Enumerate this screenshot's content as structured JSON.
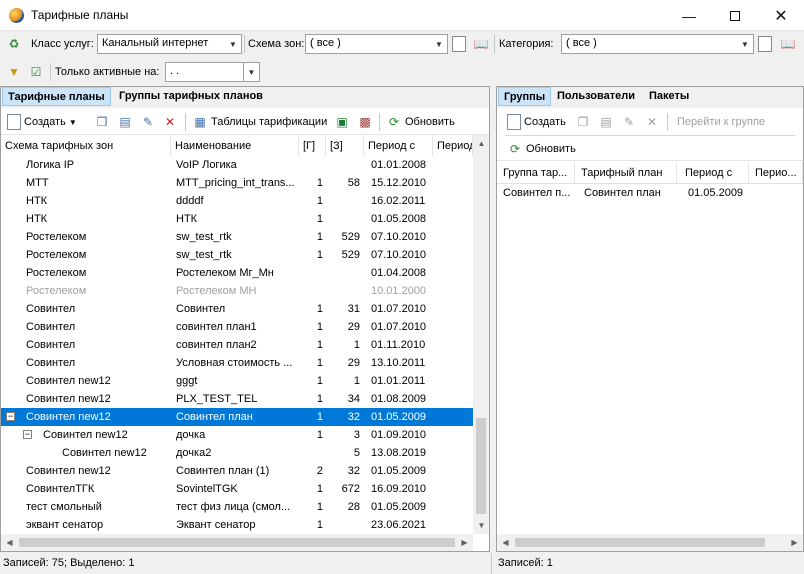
{
  "window": {
    "title": "Тарифные планы"
  },
  "filters": {
    "service_class_label": "Класс услуг:",
    "service_class_value": "Канальный интернет",
    "zone_scheme_label": "Схема зон:",
    "zone_scheme_value": "( все )",
    "category_label": "Категория:",
    "category_value": "( все )",
    "active_only_label": "Только активные на:",
    "active_only_value": " .  ."
  },
  "left": {
    "tabs": [
      "Тарифные планы",
      "Группы тарифных планов"
    ],
    "toolbar": {
      "create": "Создать",
      "tariff_tables": "Таблицы тарификации",
      "refresh": "Обновить"
    },
    "columns": [
      "Схема тарифных зон",
      "Наименование",
      "[Г]",
      "[З]",
      "Период с",
      "Период по"
    ],
    "rows": [
      {
        "scheme": "Логика IP",
        "name": "VoIP Логика",
        "g": "",
        "z": "",
        "from": "01.01.2008"
      },
      {
        "scheme": "МТТ",
        "name": "MTT_pricing_int_trans...",
        "g": "1",
        "z": "58",
        "from": "15.12.2010"
      },
      {
        "scheme": "НТК",
        "name": "ddddf",
        "g": "1",
        "z": "",
        "from": "16.02.2011"
      },
      {
        "scheme": "НТК",
        "name": "НТК",
        "g": "1",
        "z": "",
        "from": "01.05.2008"
      },
      {
        "scheme": "Ростелеком",
        "name": "sw_test_rtk",
        "g": "1",
        "z": "529",
        "from": "07.10.2010"
      },
      {
        "scheme": "Ростелеком",
        "name": "sw_test_rtk",
        "g": "1",
        "z": "529",
        "from": "07.10.2010"
      },
      {
        "scheme": "Ростелеком",
        "name": "Ростелеком Мг_Мн",
        "g": "",
        "z": "",
        "from": "01.04.2008"
      },
      {
        "scheme": "Ростелеком",
        "name": "Ростелеком МН",
        "g": "",
        "z": "",
        "from": "10.01.2000"
      },
      {
        "scheme": "Совинтел",
        "name": "Совинтел",
        "g": "1",
        "z": "31",
        "from": "01.07.2010"
      },
      {
        "scheme": "Совинтел",
        "name": "совинтел план1",
        "g": "1",
        "z": "29",
        "from": "01.07.2010"
      },
      {
        "scheme": "Совинтел",
        "name": "совинтел план2",
        "g": "1",
        "z": "1",
        "from": "01.11.2010"
      },
      {
        "scheme": "Совинтел",
        "name": "Условная стоимость ...",
        "g": "1",
        "z": "29",
        "from": "13.10.2011"
      },
      {
        "scheme": "Совинтел new12",
        "name": "gggt",
        "g": "1",
        "z": "1",
        "from": "01.01.2011"
      },
      {
        "scheme": "Совинтел new12",
        "name": "PLX_TEST_TEL",
        "g": "1",
        "z": "34",
        "from": "01.08.2009"
      },
      {
        "scheme": "Совинтел new12",
        "name": "Совинтел план",
        "g": "1",
        "z": "32",
        "from": "01.05.2009"
      },
      {
        "scheme": "Совинтел new12",
        "name": "дочка",
        "g": "1",
        "z": "3",
        "from": "01.09.2010"
      },
      {
        "scheme": "Совинтел new12",
        "name": "дочка2",
        "g": "",
        "z": "5",
        "from": "13.08.2019"
      },
      {
        "scheme": "Совинтел new12",
        "name": "Совинтел план (1)",
        "g": "2",
        "z": "32",
        "from": "01.05.2009"
      },
      {
        "scheme": "СовинтелТГК",
        "name": "SovintelTGK",
        "g": "1",
        "z": "672",
        "from": "16.09.2010"
      },
      {
        "scheme": "тест смольный",
        "name": "тест физ лица (смол...",
        "g": "1",
        "z": "28",
        "from": "01.05.2009"
      },
      {
        "scheme": "эквант сенатор",
        "name": "Эквант сенатор",
        "g": "1",
        "z": "",
        "from": "23.06.2021"
      }
    ],
    "status": "Записей: 75; Выделено: 1"
  },
  "right": {
    "tabs": [
      "Группы",
      "Пользователи",
      "Пакеты"
    ],
    "toolbar": {
      "create": "Создать",
      "goto_group": "Перейти к группе",
      "refresh": "Обновить"
    },
    "columns": [
      "Группа тар...",
      "Тарифный план",
      "Период с",
      "Перио..."
    ],
    "rows": [
      {
        "group": "Совинтел п...",
        "plan": "Совинтел план",
        "from": "01.05.2009",
        "to": ""
      }
    ],
    "status": "Записей: 1"
  },
  "colors": {
    "selection": "#0078d7",
    "tab_active": "#cce4f7",
    "disabled_text": "#a0a0a0"
  }
}
